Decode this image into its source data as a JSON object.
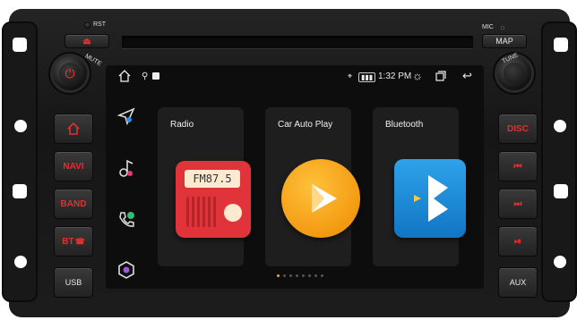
{
  "panel": {
    "rst_label": "RST",
    "mic_label": "MIC",
    "map_label": "MAP",
    "mute_label": "MUTE",
    "tune_label": "TUNE",
    "usb_label": "USB",
    "aux_label": "AUX",
    "left_buttons": [
      {
        "name": "home-button",
        "label": "",
        "icon": "home-icon"
      },
      {
        "name": "navi-button",
        "label": "NAVI"
      },
      {
        "name": "band-button",
        "label": "BAND"
      },
      {
        "name": "bt-button",
        "label": "BT"
      }
    ],
    "right_buttons": [
      {
        "name": "disc-button",
        "label": "DISC"
      },
      {
        "name": "prev-button",
        "label": "⏮",
        "icon": "previous-track-icon"
      },
      {
        "name": "next-button",
        "label": "⏭",
        "icon": "next-track-icon"
      },
      {
        "name": "play-pause-button",
        "label": "⏯",
        "icon": "play-pause-icon"
      }
    ]
  },
  "statusbar": {
    "time": "1:32 PM",
    "icons": [
      "home-icon",
      "usb-icon",
      "notification-icon",
      "location-icon",
      "wifi-icon",
      "brightness-icon",
      "recent-apps-icon",
      "back-icon"
    ]
  },
  "dock": {
    "apps": [
      "navigation-icon",
      "music-icon",
      "phone-icon",
      "settings-icon"
    ]
  },
  "apps": [
    {
      "label": "Radio",
      "display": "FM87.5",
      "icon": "radio-icon"
    },
    {
      "label": "Car Auto Play",
      "icon": "car-auto-play-icon"
    },
    {
      "label": "Bluetooth",
      "icon": "bluetooth-icon"
    }
  ],
  "pager": {
    "pages": 8,
    "active": 1
  },
  "colors": {
    "accent_red": "#e03030",
    "radio_red": "#e0333a",
    "autoplay_orange": "#f5a017",
    "bluetooth_blue": "#1a8fdc"
  }
}
